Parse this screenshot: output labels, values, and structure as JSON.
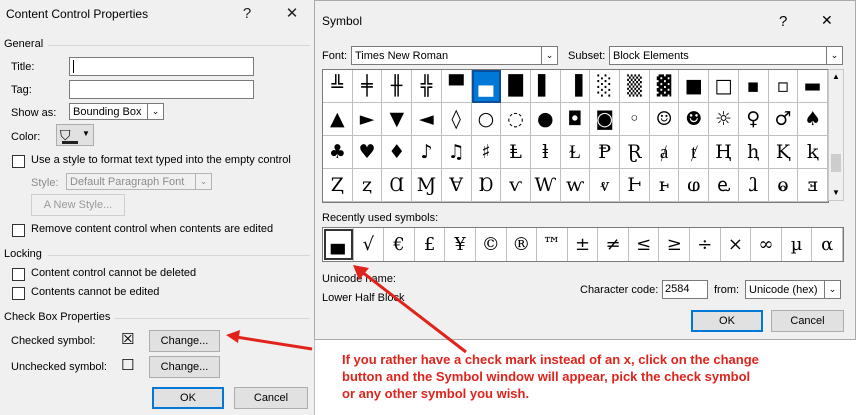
{
  "ccp": {
    "title": "Content Control Properties",
    "help_glyph": "?",
    "close_glyph": "✕",
    "general_label": "General",
    "title_label": "Title:",
    "tag_label": "Tag:",
    "show_as_label": "Show as:",
    "show_as_value": "Bounding Box",
    "color_label": "Color:",
    "use_style_label": "Use a style to format text typed into the empty control",
    "style_label": "Style:",
    "style_value": "Default Paragraph Font",
    "new_style_label": "New Style...",
    "remove_label": "Remove content control when contents are edited",
    "locking_label": "Locking",
    "lock_delete_label": "Content control cannot be deleted",
    "lock_edit_label": "Contents cannot be edited",
    "cb_props_label": "Check Box Properties",
    "checked_label": "Checked symbol:",
    "checked_glyph": "☒",
    "unchecked_label": "Unchecked symbol:",
    "unchecked_glyph": "☐",
    "change_label": "Change...",
    "ok_label": "OK",
    "cancel_label": "Cancel"
  },
  "sym": {
    "title": "Symbol",
    "help_glyph": "?",
    "close_glyph": "✕",
    "font_label": "Font:",
    "font_value": "Times New Roman",
    "subset_label": "Subset:",
    "subset_value": "Block Elements",
    "grid": [
      [
        "╩",
        "╪",
        "╫",
        "╬",
        "▀",
        "▄",
        "█",
        "▌",
        "▐",
        "░",
        "▒",
        "▓",
        "■",
        "□",
        "▪",
        "▫",
        "▬"
      ],
      [
        "▲",
        "►",
        "▼",
        "◄",
        "◊",
        "○",
        "◌",
        "●",
        "◘",
        "◙",
        "◦",
        "☺",
        "☻",
        "☼",
        "♀",
        "♂",
        "♠"
      ],
      [
        "♣",
        "♥",
        "♦",
        "♪",
        "♫",
        "♯",
        "Ⱡ",
        "ⱡ",
        "Ɫ",
        "Ᵽ",
        "Ɽ",
        "ⱥ",
        "ⱦ",
        "Ⱨ",
        "ⱨ",
        "Ⱪ",
        "ⱪ"
      ],
      [
        "Ⱬ",
        "ⱬ",
        "Ɑ",
        "Ɱ",
        "Ɐ",
        "Ɒ",
        "ⱱ",
        "Ⱳ",
        "ⱳ",
        "ⱴ",
        "Ⱶ",
        "ⱶ",
        "ⱷ",
        "ⱸ",
        "ⱹ",
        "ⱺ",
        "ⱻ"
      ]
    ],
    "recent_label": "Recently used symbols:",
    "recent": [
      "▄",
      "√",
      "€",
      "£",
      "¥",
      "©",
      "®",
      "™",
      "±",
      "≠",
      "≤",
      "≥",
      "÷",
      "×",
      "∞",
      "µ",
      "α"
    ],
    "unicode_name_label": "Unicode name:",
    "unicode_name_value": "Lower Half Block",
    "char_code_label": "Character code:",
    "char_code_value": "2584",
    "from_label": "from:",
    "from_value": "Unicode (hex)",
    "ok_label": "OK",
    "cancel_label": "Cancel"
  },
  "annotation": {
    "text": "If you rather have a check mark instead of an x, click on the change button and the Symbol window will appear, pick the check symbol or any other symbol you wish."
  },
  "colors": {
    "annotation": "#e0241c",
    "selection": "#0078d7"
  }
}
